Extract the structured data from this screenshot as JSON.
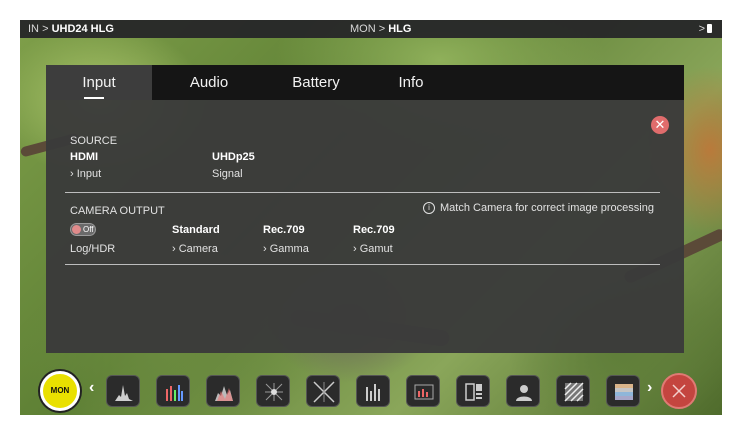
{
  "status_bar": {
    "in_label": "IN",
    "in_arrow": ">",
    "in_value": "UHD24 HLG",
    "mon_label": "MON",
    "mon_arrow": ">",
    "mon_value": "HLG",
    "right_arrow": ">"
  },
  "tabs": [
    {
      "label": "Input",
      "active": true
    },
    {
      "label": "Audio",
      "active": false
    },
    {
      "label": "Battery",
      "active": false
    },
    {
      "label": "Info",
      "active": false
    }
  ],
  "source": {
    "heading": "SOURCE",
    "input": {
      "value": "HDMI",
      "label": "› Input"
    },
    "signal": {
      "value": "UHDp25",
      "label": "Signal"
    }
  },
  "camera_output": {
    "heading": "CAMERA OUTPUT",
    "info_text": "Match Camera for correct image processing",
    "log_hdr": {
      "toggle_text": "Off",
      "label": "Log/HDR"
    },
    "camera": {
      "value": "Standard",
      "label": "› Camera"
    },
    "gamma": {
      "value": "Rec.709",
      "label": "› Gamma"
    },
    "gamut": {
      "value": "Rec.709",
      "label": "› Gamut"
    }
  },
  "dock": {
    "mon_label": "MON",
    "left_chevron": "‹",
    "right_chevron": "›",
    "tools": [
      "waveform-tool",
      "rgb-parade-tool",
      "histogram-tool",
      "vectorscope-tool",
      "zoomed-vectorscope-tool",
      "audio-meters-tool",
      "false-color-tool",
      "monitor-settings-tool",
      "anamorphic-tool",
      "zebra-tool",
      "color-bars-tool"
    ]
  },
  "colors": {
    "accent_yellow": "#e9e000",
    "close_red": "#e06c6c",
    "exit_red": "#c4453f"
  }
}
